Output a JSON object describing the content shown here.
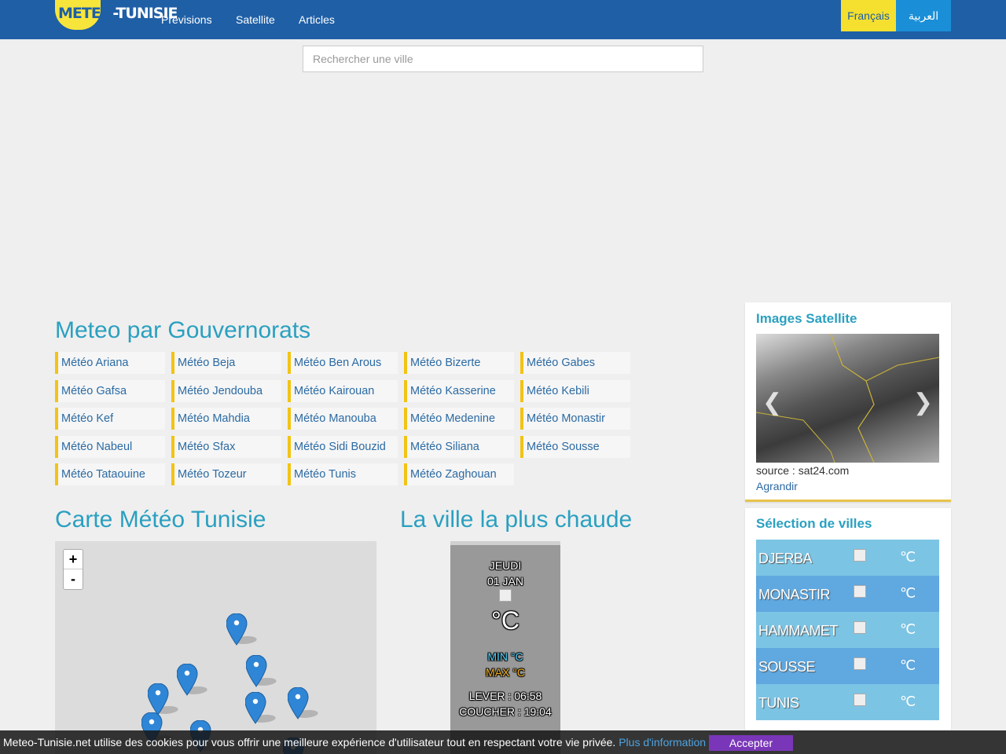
{
  "nav": {
    "logo_part1": "METEO",
    "logo_part2": "-TUNISIE",
    "links": [
      "Prévisions",
      "Satellite",
      "Articles"
    ],
    "lang_fr": "Français",
    "lang_ar": "العربية"
  },
  "search": {
    "placeholder": "Rechercher une ville"
  },
  "governorates": {
    "title": "Meteo par Gouvernorats",
    "items": [
      "Météo Ariana",
      "Météo Beja",
      "Météo Ben Arous",
      "Météo Bizerte",
      "Météo Gabes",
      "Météo Gafsa",
      "Météo Jendouba",
      "Météo Kairouan",
      "Météo Kasserine",
      "Météo Kebili",
      "Météo Kef",
      "Météo Mahdia",
      "Météo Manouba",
      "Météo Medenine",
      "Météo Monastir",
      "Météo Nabeul",
      "Météo Sfax",
      "Météo Sidi Bouzid",
      "Météo Siliana",
      "Météo Sousse",
      "Météo Tataouine",
      "Météo Tozeur",
      "Météo Tunis",
      "Météo Zaghouan"
    ]
  },
  "map": {
    "title": "Carte Météo Tunisie",
    "zoom_in": "+",
    "zoom_out": "-"
  },
  "hottest": {
    "title": "La ville la plus chaude",
    "day": "JEUDI",
    "date": "01 JAN",
    "temp": "°C",
    "min": "MIN °C",
    "max": "MAX °C",
    "sunrise": "LEVER : 06:58",
    "sunset": "COUCHER : 19:04",
    "min_color": "#4fd4ff",
    "max_color": "#f2b01e"
  },
  "satellite": {
    "title": "Images Satellite",
    "source": "source : sat24.com",
    "enlarge": "Agrandir"
  },
  "cities": {
    "title": "Sélection de villes",
    "unit": "℃",
    "rows": [
      {
        "name": "DJERBA",
        "color": "#7cc4e4"
      },
      {
        "name": "MONASTIR",
        "color": "#5fa8e0"
      },
      {
        "name": "HAMMAMET",
        "color": "#7cc4e4"
      },
      {
        "name": "SOUSSE",
        "color": "#5fa8e0"
      },
      {
        "name": "TUNIS",
        "color": "#7cc4e4"
      }
    ]
  },
  "cookie": {
    "text": "Meteo-Tunisie.net utilise des cookies pour vous offrir une meilleure expérience d'utilisateur tout en respectant votre vie privée.",
    "more": "Plus d'information",
    "accept": "Accepter"
  },
  "colors": {
    "navbar": "#1f5fa6",
    "accent_yellow": "#f2c314",
    "heading": "#2aa0c0"
  }
}
